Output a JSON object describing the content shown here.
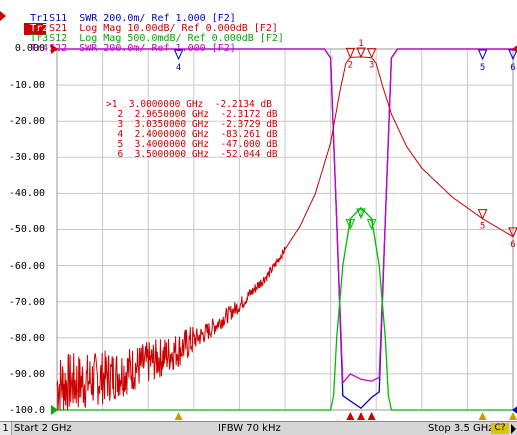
{
  "traces": [
    {
      "tag": "Tr1",
      "desc": "S11  SWR 200.0m/ Ref 1.000 [F2]",
      "color": "#0000cc",
      "active": false
    },
    {
      "tag": "Tr2",
      "desc": "S21  Log Mag 10.00dB/ Ref 0.000dB [F2]",
      "color": "#cc0000",
      "active": true
    },
    {
      "tag": "Tr3",
      "desc": "S12  Log Mag 500.0mdB/ Ref 0.000dB [F2]",
      "color": "#00bb00",
      "active": false
    },
    {
      "tag": "Tr4",
      "desc": "S22  SWR 200.0m/ Ref 1.000 [F2]",
      "color": "#cc00cc",
      "active": false
    }
  ],
  "y_axis_labels": [
    "0.000",
    "-10.00",
    "-20.00",
    "-30.00",
    "-40.00",
    "-50.00",
    "-60.00",
    "-70.00",
    "-80.00",
    "-90.00",
    "-100.0"
  ],
  "markers": [
    {
      "id": "1",
      "prefix": ">1",
      "freq_ghz": 3.0,
      "freq": "3.0000000 GHz",
      "value": "-2.2134 dB"
    },
    {
      "id": "2",
      "prefix": "2",
      "freq_ghz": 2.965,
      "freq": "2.9650000 GHz",
      "value": "-2.3172 dB"
    },
    {
      "id": "3",
      "prefix": "3",
      "freq_ghz": 3.035,
      "freq": "3.0350000 GHz",
      "value": "-2.3729 dB"
    },
    {
      "id": "4",
      "prefix": "4",
      "freq_ghz": 2.4,
      "freq": "2.4000000 GHz",
      "value": "-83.261 dB"
    },
    {
      "id": "5",
      "prefix": "5",
      "freq_ghz": 3.4,
      "freq": "3.4000000 GHz",
      "value": "-47.000 dB"
    },
    {
      "id": "6",
      "prefix": "6",
      "freq_ghz": 3.5,
      "freq": "3.5000000 GHz",
      "value": "-52.044 dB"
    }
  ],
  "status": {
    "channel": "1",
    "start": "Start 2 GHz",
    "ifbw": "IFBW 70 kHz",
    "stop": "Stop 3.5 GHz",
    "cal": "C?"
  },
  "colors": {
    "grid": "#c8c8c8",
    "s11": "#0000cc",
    "s21": "#cc0000",
    "s12": "#00bb00",
    "s22": "#cc00cc",
    "ref_marker": "#cc0000"
  },
  "chart_data": {
    "type": "line",
    "x_start_ghz": 2.0,
    "x_stop_ghz": 3.5,
    "ylim": [
      -100,
      0
    ],
    "grid": true,
    "series": [
      {
        "name": "S21",
        "x_ghz": [
          2.0,
          2.1,
          2.2,
          2.3,
          2.4,
          2.5,
          2.6,
          2.7,
          2.8,
          2.85,
          2.9,
          2.93,
          2.95,
          2.965,
          3.0,
          3.035,
          3.05,
          3.07,
          3.1,
          3.15,
          3.2,
          3.3,
          3.4,
          3.5
        ],
        "y_db": [
          -93,
          -92,
          -90,
          -87,
          -83.3,
          -78,
          -71,
          -62,
          -49,
          -40,
          -26,
          -12,
          -4,
          -2.3,
          -2.2,
          -2.4,
          -4,
          -10,
          -18,
          -27,
          -33,
          -41,
          -47,
          -52
        ]
      },
      {
        "name": "S11",
        "x_ghz": [
          2.0,
          2.88,
          2.9,
          2.92,
          2.94,
          2.965,
          3.0,
          3.035,
          3.06,
          3.08,
          3.1,
          3.12,
          3.5
        ],
        "y_swr": [
          1.0,
          1.0,
          0.95,
          0.05,
          -0.92,
          -0.95,
          -0.99,
          -0.93,
          -0.9,
          0.05,
          0.95,
          1.0,
          1.0
        ]
      },
      {
        "name": "S12",
        "x_ghz": [
          2.0,
          2.9,
          2.91,
          2.92,
          2.94,
          2.965,
          3.0,
          3.035,
          3.06,
          3.08,
          3.09,
          3.1,
          3.5
        ],
        "y_db": [
          -100,
          -100,
          -96,
          -80,
          -60,
          -47,
          -44,
          -47,
          -60,
          -80,
          -96,
          -100,
          -100
        ]
      },
      {
        "name": "S22",
        "x_ghz": [
          2.0,
          2.88,
          2.9,
          2.92,
          2.94,
          2.965,
          3.0,
          3.035,
          3.06,
          3.08,
          3.1,
          3.12,
          3.5
        ],
        "y_swr": [
          1.0,
          1.0,
          0.95,
          0.05,
          -0.85,
          -0.8,
          -0.83,
          -0.84,
          -0.82,
          0.05,
          0.95,
          1.0,
          1.0
        ]
      }
    ]
  }
}
